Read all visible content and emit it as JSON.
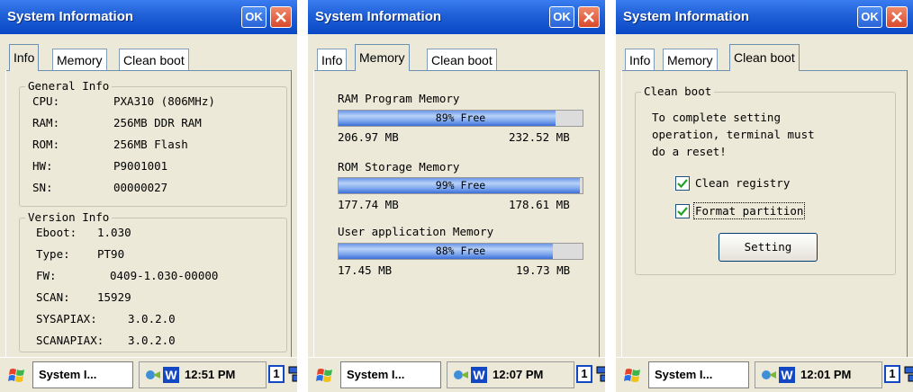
{
  "screens": [
    {
      "title": "System Information",
      "ok_label": "OK",
      "tabs": [
        "Info",
        "Memory",
        "Clean boot"
      ],
      "active_tab": "Info",
      "info": {
        "general": {
          "title": "General Info",
          "rows": [
            {
              "label": "CPU:",
              "value": "PXA310 (806MHz)"
            },
            {
              "label": "RAM:",
              "value": "256MB DDR RAM"
            },
            {
              "label": "ROM:",
              "value": "256MB Flash"
            },
            {
              "label": "HW:",
              "value": "P9001001"
            },
            {
              "label": "SN:",
              "value": "00000027"
            }
          ]
        },
        "version": {
          "title": "Version Info",
          "rows": [
            {
              "label": "Eboot:",
              "value": "1.030"
            },
            {
              "label": "Type:",
              "value": "PT90"
            },
            {
              "label": "FW:",
              "value": "0409-1.030-00000"
            },
            {
              "label": "SCAN:",
              "value": "15929"
            },
            {
              "label": "SYSAPIAX:",
              "value": "3.0.2.0"
            },
            {
              "label": "SCANAPIAX:",
              "value": "3.0.2.0"
            }
          ]
        }
      },
      "taskbar": {
        "task_label": "System I...",
        "clock": "12:51 PM",
        "kb_indicator": "1",
        "tray_letter": "W"
      }
    },
    {
      "title": "System Information",
      "ok_label": "OK",
      "tabs": [
        "Info",
        "Memory",
        "Clean boot"
      ],
      "active_tab": "Memory",
      "memory": [
        {
          "label": "RAM Program Memory",
          "free_text": "89% Free",
          "free_fraction": 0.89,
          "left": "206.97 MB",
          "right": "232.52 MB"
        },
        {
          "label": "ROM Storage Memory",
          "free_text": "99% Free",
          "free_fraction": 0.99,
          "left": "177.74 MB",
          "right": "178.61 MB"
        },
        {
          "label": "User application Memory",
          "free_text": "88% Free",
          "free_fraction": 0.88,
          "left": "17.45 MB",
          "right": "19.73 MB"
        }
      ],
      "taskbar": {
        "task_label": "System I...",
        "clock": "12:07 PM",
        "kb_indicator": "1",
        "tray_letter": "W"
      }
    },
    {
      "title": "System Information",
      "ok_label": "OK",
      "tabs": [
        "Info",
        "Memory",
        "Clean boot"
      ],
      "active_tab": "Clean boot",
      "clean_boot": {
        "group_title": "Clean boot",
        "message_lines": [
          "To complete setting",
          "operation, terminal must",
          "do a reset!"
        ],
        "options": [
          {
            "label": "Clean registry",
            "checked": true
          },
          {
            "label": "Format partition",
            "checked": true
          }
        ],
        "button_label": "Setting"
      },
      "taskbar": {
        "task_label": "System I...",
        "clock": "12:01 PM",
        "kb_indicator": "1",
        "tray_letter": "W"
      }
    }
  ],
  "colors": {
    "titlebar": "#0a49c6",
    "window_bg": "#ece9d8",
    "close_button": "#d8492c",
    "checkbox_check": "#21a121",
    "progress_fill": "#6a96e8"
  }
}
